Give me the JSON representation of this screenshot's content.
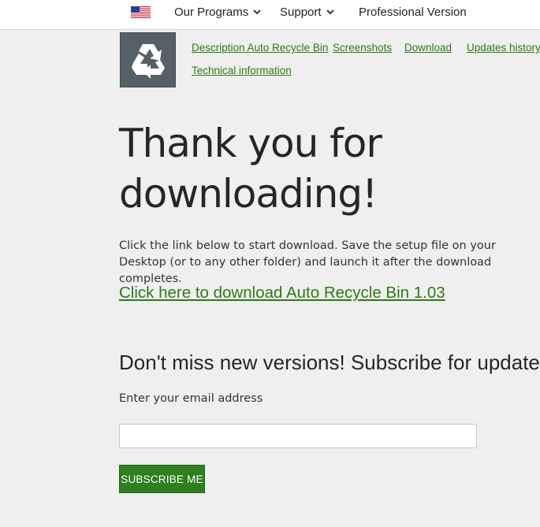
{
  "nav": {
    "flag_icon": "us-flag-icon",
    "items": [
      {
        "label": "Our Programs",
        "has_dropdown": true
      },
      {
        "label": "Support",
        "has_dropdown": true
      },
      {
        "label": "Professional Version",
        "has_dropdown": false
      }
    ]
  },
  "product": {
    "logo_icon": "recycle-icon",
    "links": [
      "Description Auto Recycle Bin",
      "Screenshots",
      "Download",
      "Updates history",
      "Technical information"
    ]
  },
  "main": {
    "heading_line1": "Thank you for",
    "heading_line2": "downloading!",
    "instruction": "Click the link below to start download. Save the setup file on your Desktop (or to any other folder) and launch it after the download completes.",
    "download_link": "Click here to download Auto Recycle Bin 1.03"
  },
  "subscribe": {
    "heading": "Don't miss new versions! Subscribe for updates!",
    "email_label": "Enter your email address",
    "email_value": "",
    "email_placeholder": "",
    "button_label": "Subscribe me"
  },
  "colors": {
    "link": "#2e7a16",
    "button_bg": "#2e7f1e",
    "background": "#efefef",
    "logo_bg": "#566167"
  }
}
